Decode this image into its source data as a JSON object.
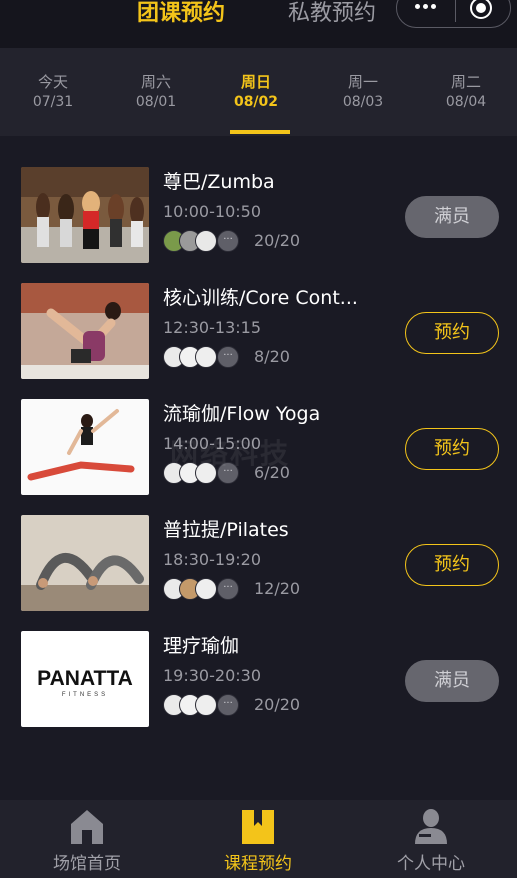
{
  "header": {
    "tab_active": "团课预约",
    "tab_inactive": "私教预约"
  },
  "dates": [
    {
      "name": "今天",
      "date": "07/31",
      "active": false
    },
    {
      "name": "周六",
      "date": "08/01",
      "active": false
    },
    {
      "name": "周日",
      "date": "08/02",
      "active": true
    },
    {
      "name": "周一",
      "date": "08/03",
      "active": false
    },
    {
      "name": "周二",
      "date": "08/04",
      "active": false
    }
  ],
  "classes": [
    {
      "title": "尊巴/Zumba",
      "time": "10:00-10:50",
      "count": "20/20",
      "button": "满员",
      "status": "full"
    },
    {
      "title": "核心训练/Core Cont...",
      "time": "12:30-13:15",
      "count": "8/20",
      "button": "预约",
      "status": "book"
    },
    {
      "title": "流瑜伽/Flow Yoga",
      "time": "14:00-15:00",
      "count": "6/20",
      "button": "预约",
      "status": "book"
    },
    {
      "title": "普拉提/Pilates",
      "time": "18:30-19:20",
      "count": "12/20",
      "button": "预约",
      "status": "book"
    },
    {
      "title": "理疗瑜伽",
      "time": "19:30-20:30",
      "count": "20/20",
      "button": "满员",
      "status": "full"
    }
  ],
  "avatar_more": "···",
  "watermark": "网络科技",
  "logo": {
    "brand": "PANATTA",
    "sub": "FITNESS"
  },
  "bottom_nav": [
    {
      "label": "场馆首页",
      "icon": "home-icon",
      "active": false
    },
    {
      "label": "课程预约",
      "icon": "bookmark-icon",
      "active": true
    },
    {
      "label": "个人中心",
      "icon": "user-icon",
      "active": false
    }
  ],
  "colors": {
    "accent": "#f3c41a",
    "background": "#1a1a24",
    "button_full": "#66666e",
    "muted_text": "#9a9aa2"
  }
}
